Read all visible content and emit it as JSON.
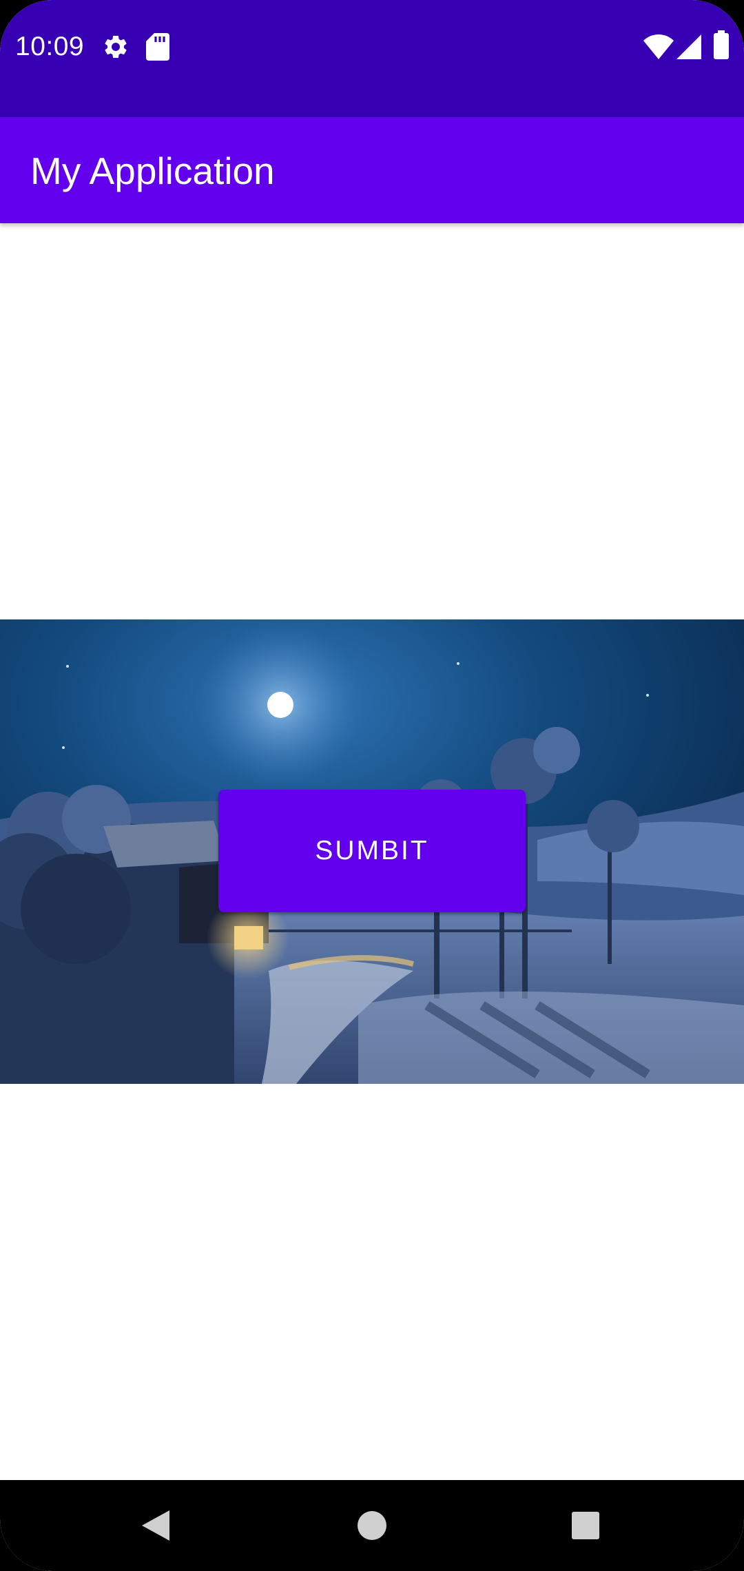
{
  "status_bar": {
    "time": "10:09",
    "background_color": "#3700b3",
    "left_icons": [
      "gear-icon",
      "sd-card-icon"
    ],
    "right_icons": [
      "wifi-icon",
      "cell-signal-icon",
      "battery-icon"
    ]
  },
  "app_bar": {
    "title": "My Application",
    "background_color": "#6200ee"
  },
  "main": {
    "image": "night-landscape-image",
    "submit_button": {
      "label": "SUMBIT",
      "background_color": "#6200ee"
    }
  },
  "nav_bar": {
    "buttons": [
      "back-icon",
      "home-icon",
      "recents-icon"
    ]
  }
}
